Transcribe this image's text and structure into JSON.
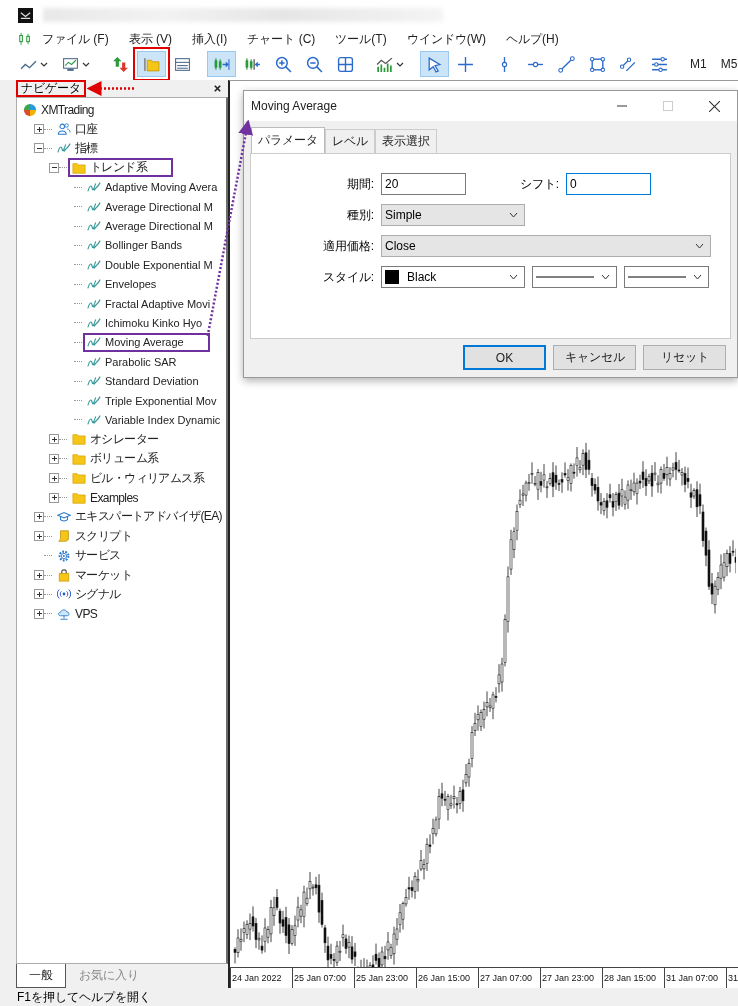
{
  "menu": {
    "items": [
      {
        "label": "ファイル (F)"
      },
      {
        "label": "表示 (V)"
      },
      {
        "label": "挿入(I)"
      },
      {
        "label": "チャート (C)"
      },
      {
        "label": "ツール(T)"
      },
      {
        "label": "ウインドウ(W)"
      },
      {
        "label": "ヘルプ(H)"
      }
    ]
  },
  "toolbar": {
    "items": [
      {
        "kind": "line-chart",
        "dropdown": true,
        "active": false,
        "annotated": false
      },
      {
        "kind": "template",
        "dropdown": true,
        "active": false,
        "annotated": false
      },
      {
        "kind": "separator"
      },
      {
        "kind": "market-watch",
        "dropdown": false,
        "active": false,
        "annotated": false
      },
      {
        "kind": "navigator",
        "dropdown": false,
        "active": true,
        "annotated": true
      },
      {
        "kind": "data-window",
        "dropdown": false,
        "active": false,
        "annotated": false
      },
      {
        "kind": "separator"
      },
      {
        "kind": "autoscroll",
        "dropdown": false,
        "active": true,
        "annotated": false
      },
      {
        "kind": "chart-shift",
        "dropdown": false,
        "active": false,
        "annotated": false
      },
      {
        "kind": "zoom-in",
        "dropdown": false,
        "active": false,
        "annotated": false
      },
      {
        "kind": "zoom-out",
        "dropdown": false,
        "active": false,
        "annotated": false
      },
      {
        "kind": "tile",
        "dropdown": false,
        "active": false,
        "annotated": false
      },
      {
        "kind": "separator"
      },
      {
        "kind": "indicators",
        "dropdown": true,
        "active": false,
        "annotated": false
      },
      {
        "kind": "separator"
      },
      {
        "kind": "cursor",
        "dropdown": false,
        "active": true,
        "annotated": false
      },
      {
        "kind": "crosshair",
        "dropdown": false,
        "active": false,
        "annotated": false
      },
      {
        "kind": "separator"
      },
      {
        "kind": "vline",
        "dropdown": false,
        "active": false,
        "annotated": false
      },
      {
        "kind": "hline",
        "dropdown": false,
        "active": false,
        "annotated": false
      },
      {
        "kind": "trendline",
        "dropdown": false,
        "active": false,
        "annotated": false
      },
      {
        "kind": "rectangle",
        "dropdown": false,
        "active": false,
        "annotated": false
      },
      {
        "kind": "channel",
        "dropdown": false,
        "active": false,
        "annotated": false
      },
      {
        "kind": "objects",
        "dropdown": false,
        "active": false,
        "annotated": false
      },
      {
        "kind": "separator"
      },
      {
        "kind": "timeframe",
        "label": "M1",
        "dropdown": false,
        "active": false,
        "annotated": false
      },
      {
        "kind": "timeframe",
        "label": "M5",
        "dropdown": false,
        "active": false,
        "annotated": false
      }
    ]
  },
  "navigator": {
    "title": "ナビゲータ",
    "annotated": true,
    "tree": [
      {
        "label": "XMTrading",
        "kind": "root",
        "children": [
          {
            "label": "口座",
            "kind": "account",
            "expanded": false,
            "annotated": false
          },
          {
            "label": "指標",
            "kind": "indicator",
            "expanded": true,
            "annotated": false,
            "children": [
              {
                "label": "トレンド系",
                "kind": "folder",
                "expanded": true,
                "annotated": true,
                "children": [
                  {
                    "label": "Adaptive Moving Avera",
                    "kind": "indicator",
                    "annotated": false
                  },
                  {
                    "label": "Average Directional M",
                    "kind": "indicator",
                    "annotated": false
                  },
                  {
                    "label": "Average Directional M",
                    "kind": "indicator",
                    "annotated": false
                  },
                  {
                    "label": "Bollinger Bands",
                    "kind": "indicator",
                    "annotated": false
                  },
                  {
                    "label": "Double Exponential M",
                    "kind": "indicator",
                    "annotated": false
                  },
                  {
                    "label": "Envelopes",
                    "kind": "indicator",
                    "annotated": false
                  },
                  {
                    "label": "Fractal Adaptive Movi",
                    "kind": "indicator",
                    "annotated": false
                  },
                  {
                    "label": "Ichimoku Kinko Hyo",
                    "kind": "indicator",
                    "annotated": false
                  },
                  {
                    "label": "Moving Average",
                    "kind": "indicator",
                    "annotated": true
                  },
                  {
                    "label": "Parabolic SAR",
                    "kind": "indicator",
                    "annotated": false
                  },
                  {
                    "label": "Standard Deviation",
                    "kind": "indicator",
                    "annotated": false
                  },
                  {
                    "label": "Triple Exponential Mov",
                    "kind": "indicator",
                    "annotated": false
                  },
                  {
                    "label": "Variable Index Dynamic",
                    "kind": "indicator",
                    "annotated": false
                  }
                ]
              },
              {
                "label": "オシレーター",
                "kind": "folder",
                "expanded": false,
                "annotated": false
              },
              {
                "label": "ボリューム系",
                "kind": "folder",
                "expanded": false,
                "annotated": false
              },
              {
                "label": "ビル・ウィリアムス系",
                "kind": "folder",
                "expanded": false,
                "annotated": false
              },
              {
                "label": "Examples",
                "kind": "folder",
                "expanded": false,
                "annotated": false
              }
            ]
          },
          {
            "label": "エキスパートアドバイザ(EA)",
            "kind": "ea",
            "expanded": false,
            "annotated": false
          },
          {
            "label": "スクリプト",
            "kind": "script",
            "expanded": false,
            "annotated": false
          },
          {
            "label": "サービス",
            "kind": "service",
            "annotated": false
          },
          {
            "label": "マーケット",
            "kind": "market",
            "expanded": false,
            "annotated": false
          },
          {
            "label": "シグナル",
            "kind": "signal",
            "expanded": false,
            "annotated": false
          },
          {
            "label": "VPS",
            "kind": "vps",
            "expanded": false,
            "annotated": false
          }
        ]
      }
    ],
    "tabs": [
      {
        "label": "一般",
        "selected": true
      },
      {
        "label": "お気に入り",
        "selected": false
      }
    ]
  },
  "chart": {
    "time_labels": [
      "24 Jan 2022",
      "25 Jan 07:00",
      "25 Jan 23:00",
      "26 Jan 15:00",
      "27 Jan 07:00",
      "27 Jan 23:00",
      "28 Jan 15:00",
      "31 Jan 07:00",
      "31"
    ]
  },
  "dialog": {
    "title": "Moving Average",
    "maximize_enabled": false,
    "tabs": [
      {
        "label": "パラメータ",
        "selected": true
      },
      {
        "label": "レベル",
        "selected": false
      },
      {
        "label": "表示選択",
        "selected": false
      }
    ],
    "period": {
      "label": "期間:",
      "value": "20"
    },
    "shift": {
      "label": "シフト:",
      "value": "0",
      "focused": true
    },
    "method": {
      "label": "種別:",
      "value": "Simple"
    },
    "price": {
      "label": "適用価格:",
      "value": "Close"
    },
    "style": {
      "label": "スタイル:",
      "color_name": "Black",
      "color": "#000000",
      "lines": [
        {
          "dashed": false
        },
        {
          "dashed": false
        }
      ]
    },
    "buttons": [
      {
        "label": "OK",
        "default": true
      },
      {
        "label": "キャンセル",
        "default": false
      },
      {
        "label": "リセット",
        "default": false
      }
    ]
  },
  "status_bar": {
    "text": "F1を押してヘルプを開く"
  }
}
